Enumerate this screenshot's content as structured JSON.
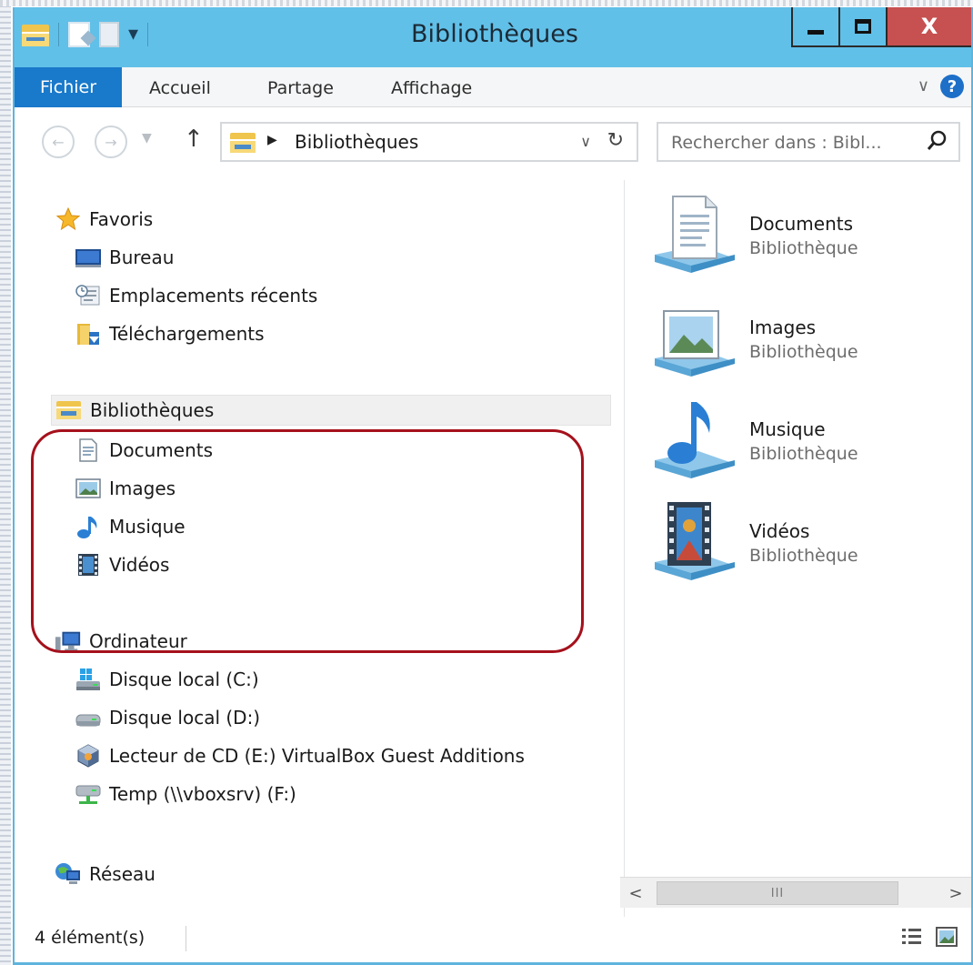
{
  "window": {
    "title": "Bibliothèques",
    "close_label": "X"
  },
  "ribbon": {
    "tabs": [
      {
        "label": "Fichier"
      },
      {
        "label": "Accueil"
      },
      {
        "label": "Partage"
      },
      {
        "label": "Affichage"
      }
    ]
  },
  "addressbar": {
    "path": "Bibliothèques"
  },
  "search": {
    "placeholder": "Rechercher dans : Bibl..."
  },
  "navpane": {
    "favorites": {
      "label": "Favoris",
      "items": [
        {
          "label": "Bureau"
        },
        {
          "label": "Emplacements récents"
        },
        {
          "label": "Téléchargements"
        }
      ]
    },
    "libraries": {
      "label": "Bibliothèques",
      "items": [
        {
          "label": "Documents"
        },
        {
          "label": "Images"
        },
        {
          "label": "Musique"
        },
        {
          "label": "Vidéos"
        }
      ]
    },
    "computer": {
      "label": "Ordinateur",
      "items": [
        {
          "label": "Disque local (C:)"
        },
        {
          "label": "Disque local (D:)"
        },
        {
          "label": "Lecteur de CD (E:) VirtualBox Guest Additions"
        },
        {
          "label": "Temp (\\\\vboxsrv) (F:)"
        }
      ]
    },
    "network": {
      "label": "Réseau"
    }
  },
  "content": {
    "items": [
      {
        "name": "Documents",
        "type": "Bibliothèque"
      },
      {
        "name": "Images",
        "type": "Bibliothèque"
      },
      {
        "name": "Musique",
        "type": "Bibliothèque"
      },
      {
        "name": "Vidéos",
        "type": "Bibliothèque"
      }
    ]
  },
  "scrollbar": {
    "thumb_grip": "III"
  },
  "statusbar": {
    "count": "4 élément(s)"
  },
  "colors": {
    "titlebar": "#61c0e8",
    "file_tab": "#1979ca",
    "close_button": "#c75050",
    "highlight_outline": "#a5111c"
  }
}
